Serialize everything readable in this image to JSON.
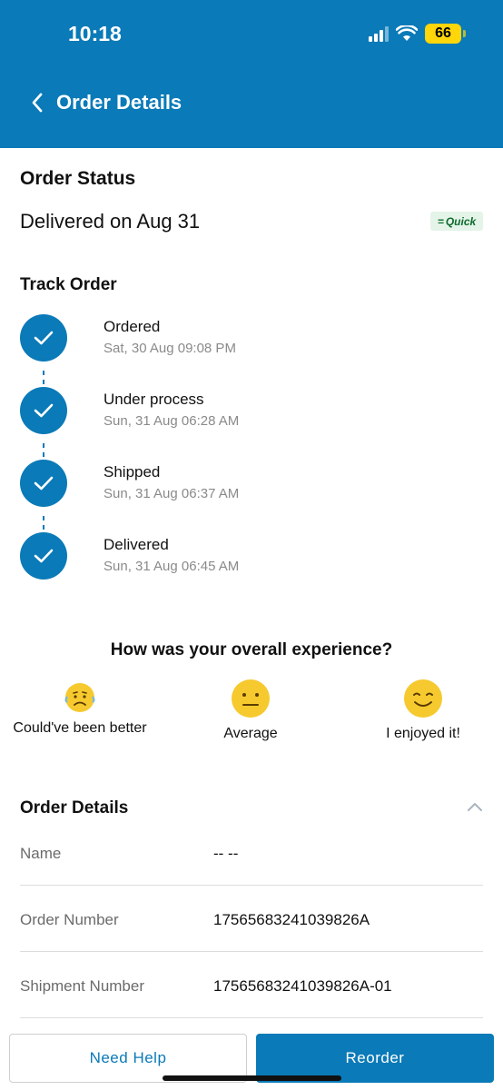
{
  "status_bar": {
    "time": "10:18",
    "battery": "66"
  },
  "header": {
    "title": "Order Details"
  },
  "order_status": {
    "heading": "Order Status",
    "delivered_text": "Delivered on Aug 31",
    "badge": "Quick"
  },
  "track": {
    "heading": "Track Order",
    "steps": [
      {
        "label": "Ordered",
        "time": "Sat, 30 Aug 09:08 PM"
      },
      {
        "label": "Under process",
        "time": "Sun, 31 Aug 06:28 AM"
      },
      {
        "label": "Shipped",
        "time": "Sun, 31 Aug 06:37 AM"
      },
      {
        "label": "Delivered",
        "time": "Sun, 31 Aug 06:45 AM"
      }
    ]
  },
  "experience": {
    "question": "How was your overall experience?",
    "options": [
      {
        "label": "Could've been better",
        "icon": "sad-face-icon"
      },
      {
        "label": "Average",
        "icon": "neutral-face-icon"
      },
      {
        "label": "I enjoyed it!",
        "icon": "smile-face-icon"
      }
    ]
  },
  "details": {
    "heading": "Order Details",
    "rows": [
      {
        "key": "Name",
        "value": "-- --"
      },
      {
        "key": "Order Number",
        "value": "17565683241039826A"
      },
      {
        "key": "Shipment Number",
        "value": "17565683241039826A-01"
      }
    ]
  },
  "actions": {
    "help_label": "Need Help",
    "reorder_label": "Reorder"
  },
  "colors": {
    "brand": "#0a7ab8",
    "badge_green": "#0e6b2c",
    "emoji_yellow": "#f6c92f"
  }
}
